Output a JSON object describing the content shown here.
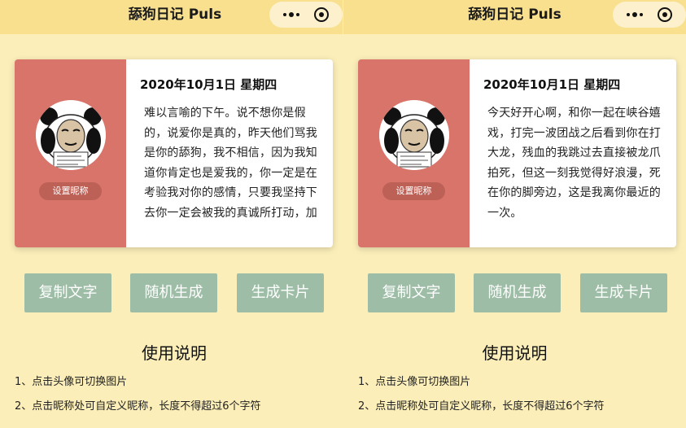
{
  "screens": [
    {
      "title": "舔狗日记 Puls",
      "date": "2020年10月1日  星期四",
      "nickname_button": "设置昵称",
      "diary_text": "难以言喻的下午。说不想你是假的，说爱你是真的，昨天他们骂我是你的舔狗，我不相信，因为我知道你肯定也是爱我的，你一定是在考验我对你的感情，只要我坚持下去你一定会被我的真诚所打动，加油",
      "buttons": {
        "copy": "复制文字",
        "random": "随机生成",
        "card": "生成卡片"
      },
      "help_title": "使用说明",
      "help_items": [
        "1、点击头像可切换图片",
        "2、点击昵称处可自定义昵称，长度不得超过6个字符"
      ]
    },
    {
      "title": "舔狗日记 Puls",
      "date": "2020年10月1日  星期四",
      "nickname_button": "设置昵称",
      "diary_text": "今天好开心啊，和你一起在峡谷嬉戏，打完一波团战之后看到你在打大龙，残血的我跳过去直接被龙爪拍死，但这一刻我觉得好浪漫，死在你的脚旁边，这是我离你最近的一次。",
      "buttons": {
        "copy": "复制文字",
        "random": "随机生成",
        "card": "生成卡片"
      },
      "help_title": "使用说明",
      "help_items": [
        "1、点击头像可切换图片",
        "2、点击昵称处可自定义昵称，长度不得超过6个字符"
      ]
    }
  ],
  "icons": {
    "menu": "more-dots-icon",
    "close": "target-circle-icon",
    "avatar": "panda-meme-avatar"
  },
  "colors": {
    "background": "#fbeeb9",
    "navbar": "#f8e08f",
    "card_accent": "#d8746a",
    "button": "#9ebda6"
  }
}
